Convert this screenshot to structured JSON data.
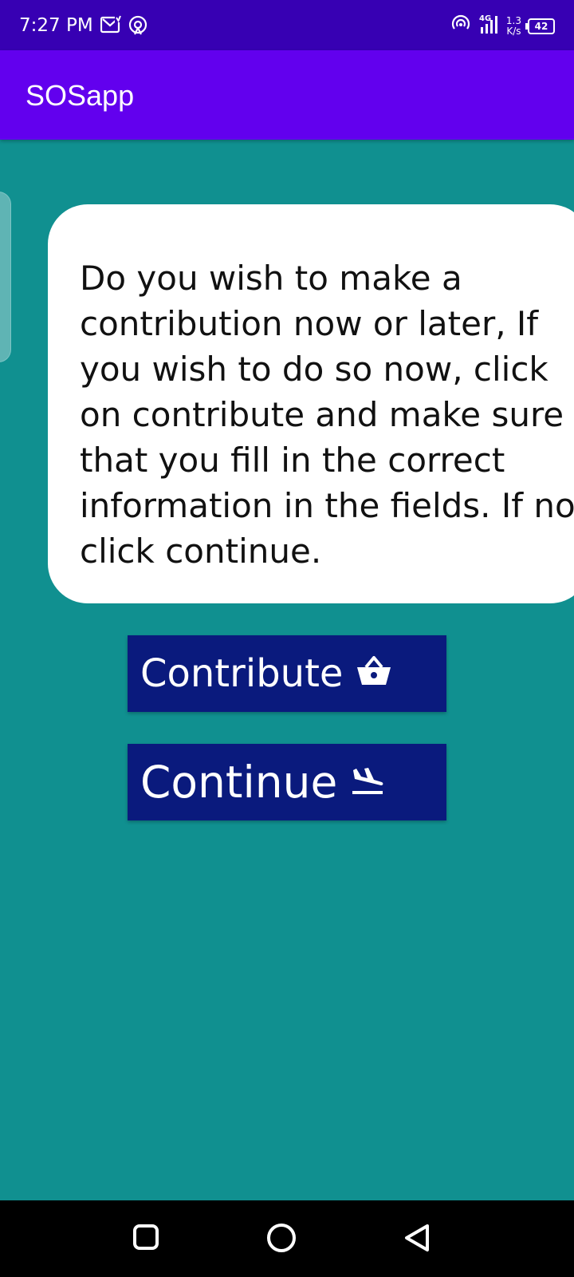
{
  "status_bar": {
    "time": "7:27 PM",
    "left_icons": [
      "gmail-icon",
      "hotspot-icon"
    ],
    "right_icons": [
      "hotspot-icon",
      "signal-4g-icon"
    ],
    "network_speed_value": "1.3",
    "network_speed_unit": "K/s",
    "battery_level": "42"
  },
  "app_bar": {
    "title": "SOSapp",
    "color": "#6200EE"
  },
  "message": {
    "text": "Do you wish to make a contribution now or later, If you wish to do so now, click on contribute and make sure that you fill in the correct information in the fields. If not click continue."
  },
  "buttons": {
    "contribute": {
      "label": "Contribute",
      "icon": "basket-icon"
    },
    "continue": {
      "label": "Continue",
      "icon": "flight-land-icon"
    }
  },
  "nav_bar": {
    "items": [
      "recent-apps-icon",
      "home-icon",
      "back-icon"
    ]
  },
  "colors": {
    "background": "#109090",
    "status_bar": "#3700B3",
    "button": "#0A1A7D"
  }
}
